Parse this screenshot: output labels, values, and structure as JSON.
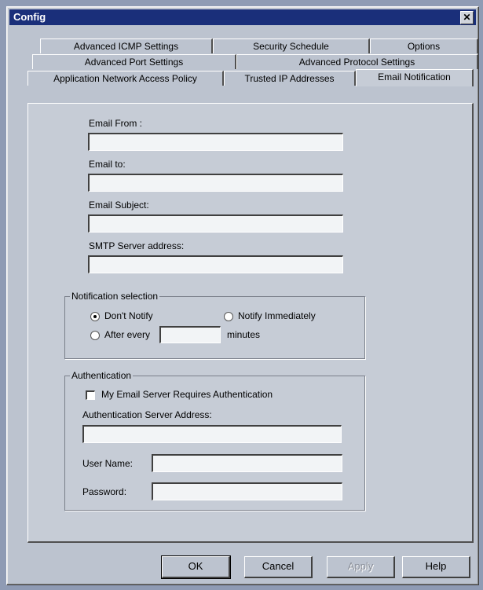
{
  "window": {
    "title": "Config",
    "close_glyph": "✕"
  },
  "tabs": {
    "row1": [
      "Advanced ICMP Settings",
      "Security Schedule",
      "Options"
    ],
    "row2": [
      "Advanced Port Settings",
      "Advanced Protocol Settings"
    ],
    "row3": [
      "Application Network Access Policy",
      "Trusted IP Addresses",
      "Email Notification"
    ],
    "active": "Email Notification"
  },
  "email": {
    "from_label": "Email From :",
    "from_value": "",
    "to_label": "Email to:",
    "to_value": "",
    "subject_label": "Email Subject:",
    "subject_value": "",
    "smtp_label": "SMTP Server address:",
    "smtp_value": ""
  },
  "notification": {
    "group_title": "Notification selection",
    "dont_notify": "Don't Notify",
    "notify_immediately": "Notify Immediately",
    "after_every": "After every",
    "minutes_value": "",
    "minutes_label": "minutes",
    "selected": "dont_notify"
  },
  "auth": {
    "group_title": "Authentication",
    "requires_auth_label": "My Email Server Requires Authentication",
    "requires_auth_checked": false,
    "server_label": "Authentication Server Address:",
    "server_value": "",
    "username_label": "User Name:",
    "username_value": "",
    "password_label": "Password:",
    "password_value": ""
  },
  "buttons": {
    "ok": "OK",
    "cancel": "Cancel",
    "apply": "Apply",
    "help": "Help"
  },
  "colors": {
    "titlebar": "#1a2f7a",
    "dialog_face": "#bcc3cf"
  }
}
